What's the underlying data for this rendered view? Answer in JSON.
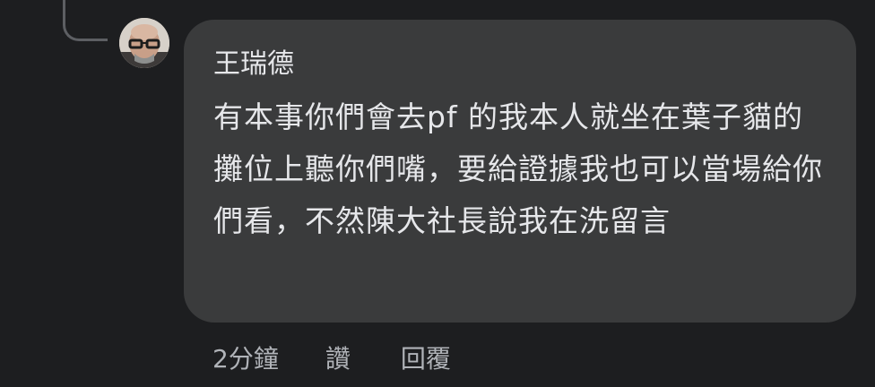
{
  "comment": {
    "author": "王瑞德",
    "text": "有本事你們會去pf 的我本人就坐在葉子貓的攤位上聽你們嘴，要給證據我也可以當場給你們看，不然陳大社長說我在洗留言"
  },
  "actions": {
    "timestamp": "2分鐘",
    "like_label": "讚",
    "reply_label": "回覆"
  }
}
